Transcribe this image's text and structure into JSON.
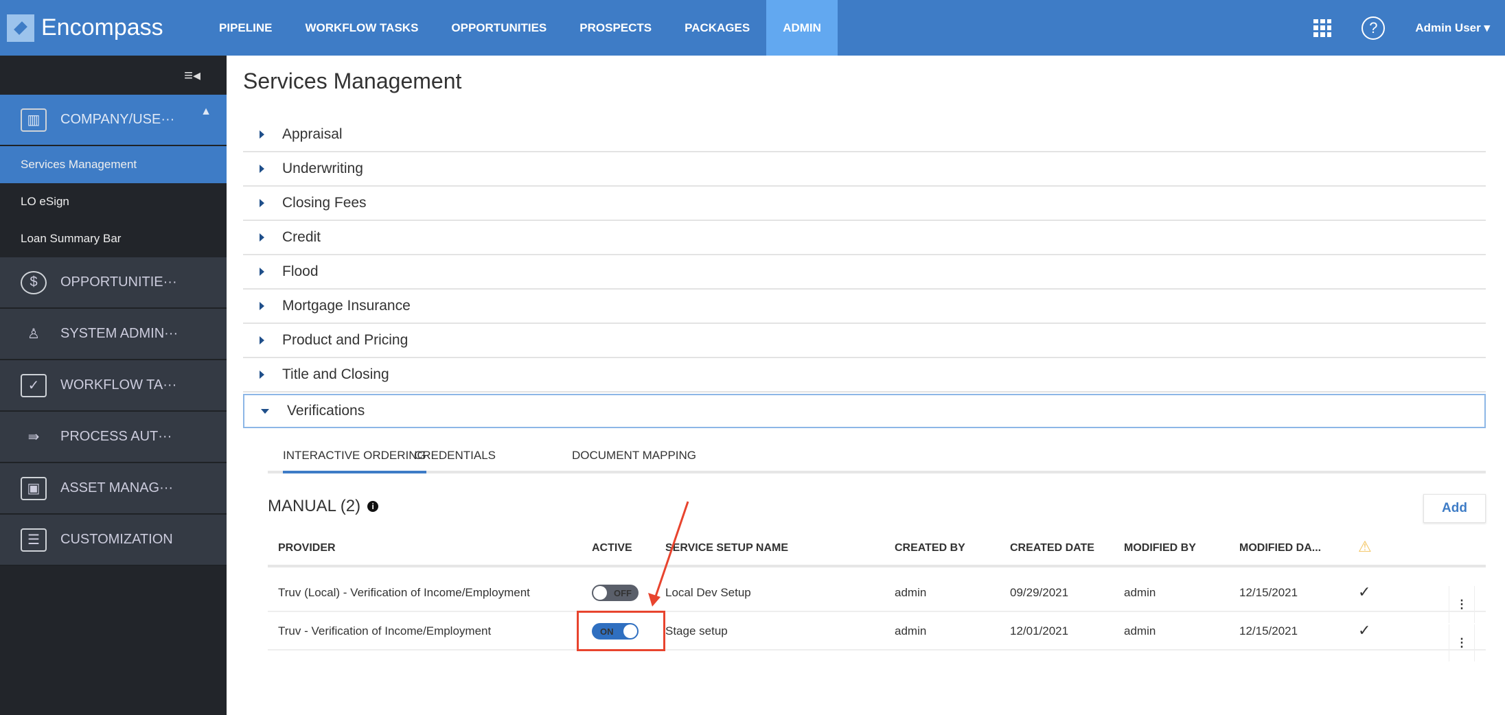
{
  "header": {
    "brand": "Encompass",
    "nav": [
      "PIPELINE",
      "WORKFLOW TASKS",
      "OPPORTUNITIES",
      "PROSPECTS",
      "PACKAGES",
      "ADMIN"
    ],
    "active_nav": "ADMIN",
    "help": "?",
    "user": "Admin User ▾"
  },
  "sidebar": {
    "collapse_icon": "≡◂",
    "sections": [
      {
        "label": "COMPANY/USE···",
        "icon": "company-icon",
        "glyph": "▥",
        "expanded": true,
        "caret": "▲"
      },
      {
        "label": "OPPORTUNITIE···",
        "icon": "dollar-icon",
        "glyph": "$"
      },
      {
        "label": "SYSTEM ADMIN···",
        "icon": "user-icon",
        "glyph": "♙"
      },
      {
        "label": "WORKFLOW TA···",
        "icon": "clipboard-icon",
        "glyph": "✓"
      },
      {
        "label": "PROCESS AUT···",
        "icon": "process-icon",
        "glyph": "⇛"
      },
      {
        "label": "ASSET MANAG···",
        "icon": "asset-icon",
        "glyph": "▣"
      },
      {
        "label": "CUSTOMIZATION",
        "icon": "list-icon",
        "glyph": "☰"
      }
    ],
    "subitems": [
      "Services Management",
      "LO eSign",
      "Loan Summary Bar"
    ],
    "selected": "Services Management"
  },
  "main": {
    "title": "Services Management",
    "accordion": [
      "Appraisal",
      "Underwriting",
      "Closing Fees",
      "Credit",
      "Flood",
      "Mortgage Insurance",
      "Product and Pricing",
      "Title and Closing",
      "Verifications"
    ],
    "expanded": "Verifications",
    "tabs": [
      "INTERACTIVE ORDERING",
      "CREDENTIALS",
      "DOCUMENT MAPPING"
    ],
    "active_tab": "INTERACTIVE ORDERING",
    "manual_label": "MANUAL (2)",
    "info": "i",
    "add": "Add",
    "columns": [
      "PROVIDER",
      "ACTIVE",
      "SERVICE SETUP NAME",
      "CREATED BY",
      "CREATED DATE",
      "MODIFIED BY",
      "MODIFIED DA...",
      "⚠"
    ],
    "rows": [
      {
        "provider": "Truv (Local) - Verification of Income/Employment",
        "active": "OFF",
        "setup": "Local Dev Setup",
        "created_by": "admin",
        "created_date": "09/29/2021",
        "modified_by": "admin",
        "modified_date": "12/15/2021",
        "check": "✓",
        "menu": "⋮"
      },
      {
        "provider": "Truv - Verification of Income/Employment",
        "active": "ON",
        "setup": "Stage setup",
        "created_by": "admin",
        "created_date": "12/01/2021",
        "modified_by": "admin",
        "modified_date": "12/15/2021",
        "check": "✓",
        "menu": "⋮"
      }
    ]
  },
  "colors": {
    "header": "#3e7cc6",
    "active_nav": "#62a8f0",
    "sidebar": "#22252a",
    "annotation": "#e8442e",
    "warning": "#f3c25a"
  }
}
